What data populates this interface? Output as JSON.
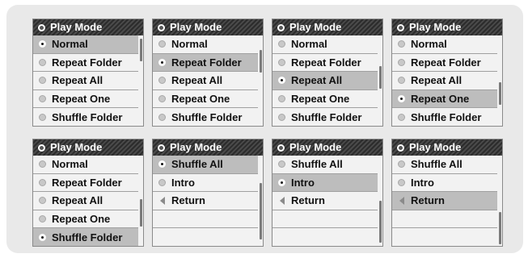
{
  "panels": [
    {
      "title": "Play Mode",
      "items": [
        "Normal",
        "Repeat Folder",
        "Repeat All",
        "Repeat One",
        "Shuffle Folder"
      ],
      "selected": 0
    },
    {
      "title": "Play Mode",
      "items": [
        "Normal",
        "Repeat Folder",
        "Repeat All",
        "Repeat One",
        "Shuffle Folder"
      ],
      "selected": 1
    },
    {
      "title": "Play Mode",
      "items": [
        "Normal",
        "Repeat Folder",
        "Repeat All",
        "Repeat One",
        "Shuffle Folder"
      ],
      "selected": 2
    },
    {
      "title": "Play Mode",
      "items": [
        "Normal",
        "Repeat Folder",
        "Repeat All",
        "Repeat One",
        "Shuffle Folder"
      ],
      "selected": 3
    },
    {
      "title": "Play Mode",
      "items": [
        "Normal",
        "Repeat Folder",
        "Repeat All",
        "Repeat One",
        "Shuffle Folder"
      ],
      "selected": 4
    },
    {
      "title": "Play Mode",
      "items": [
        "Shuffle All",
        "Intro",
        "Return"
      ],
      "selected": 0
    },
    {
      "title": "Play Mode",
      "items": [
        "Shuffle All",
        "Intro",
        "Return"
      ],
      "selected": 1
    },
    {
      "title": "Play Mode",
      "items": [
        "Shuffle All",
        "Intro",
        "Return"
      ],
      "selected": 2
    }
  ],
  "colors": {
    "title_bar": "#333333",
    "highlight": "#bdbdbd",
    "background": "#e9e9e9"
  },
  "icons": {
    "title": "radio-dot-icon",
    "option": "radio-button-icon",
    "return": "back-arrow-icon"
  }
}
